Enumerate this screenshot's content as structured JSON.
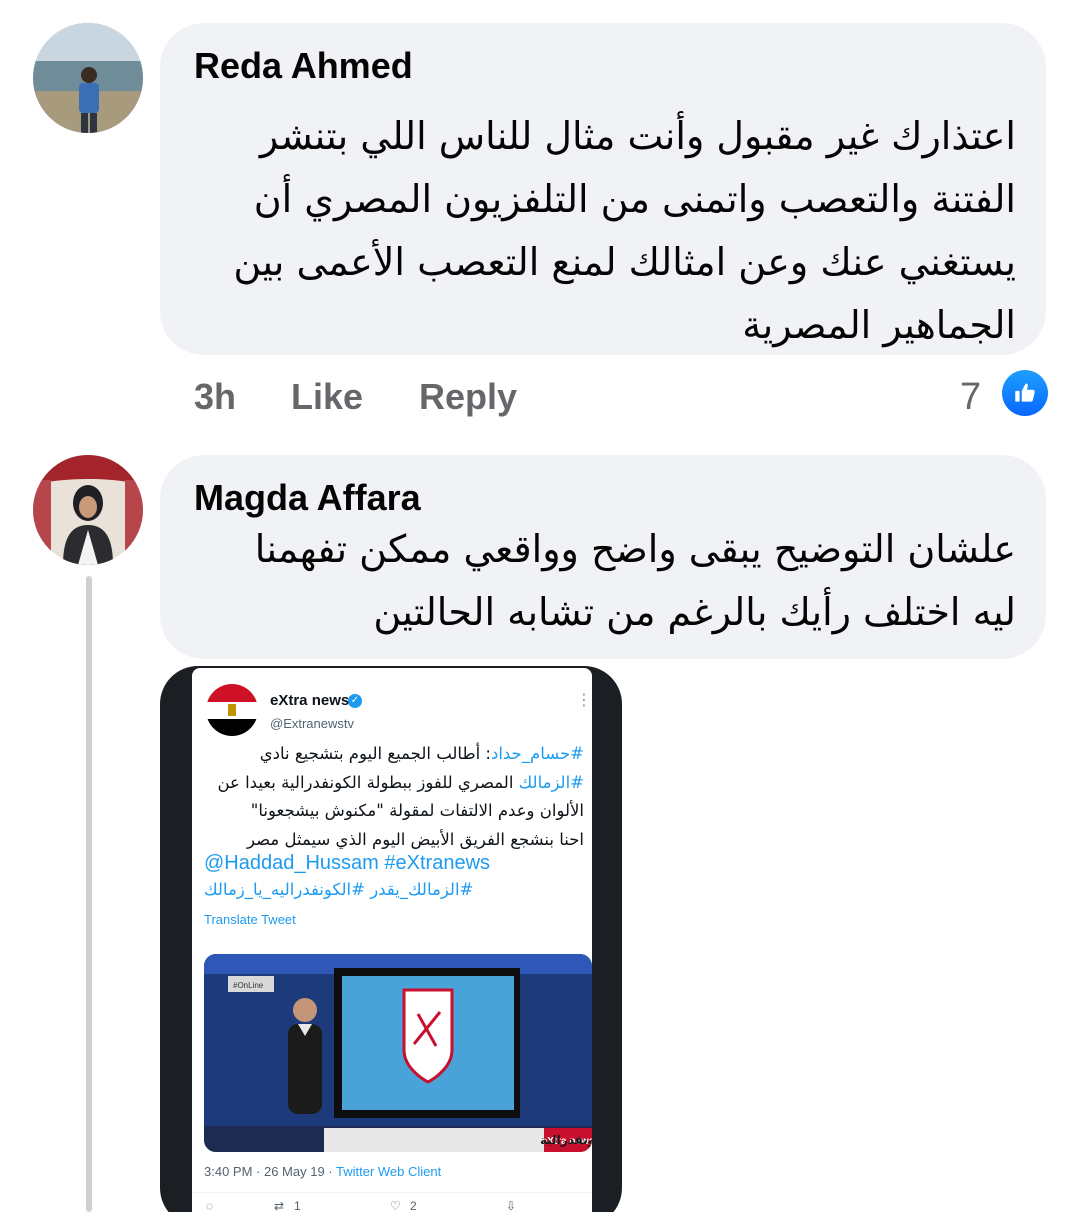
{
  "comments": [
    {
      "author": "Reda Ahmed",
      "text_lines": [
        "اعتذارك غير مقبول وأنت مثال للناس اللي بتنشر",
        "الفتنة والتعصب واتمنى من التلفزيون المصري أن",
        "يستغني عنك وعن امثالك لمنع التعصب الأعمى بين",
        "الجماهير المصرية"
      ],
      "time": "3h",
      "like_label": "Like",
      "reply_label": "Reply",
      "reaction_count": "7",
      "reaction_icon": "thumbs-up-icon",
      "reaction_color": "#1877f2"
    },
    {
      "author": "Magda Affara",
      "text_lines": [
        "علشان التوضيح يبقى واضح وواقعي  ممكن تفهمنا",
        "ليه اختلف رأيك بالرغم من تشابه الحالتين"
      ],
      "attachment": {
        "account_name": "eXtra news",
        "handle": "@Extranewstv",
        "lines": [
          {
            "link": "#حسام_حداد",
            "text": ": أطالب الجميع اليوم بتشجيع نادي"
          },
          {
            "link": "#الزمالك",
            "text": " المصري للفوز ببطولة الكونفدرالية بعيدا عن"
          },
          {
            "link": "",
            "text": "الألوان وعدم الالتفات لمقولة \"مكنوش بيشجعونا\""
          },
          {
            "link": "",
            "text": "احنا بنشجع الفريق الأبيض اليوم الذي سيمثل مصر"
          }
        ],
        "mentions": "@Haddad_Hussam #eXtranews",
        "hashtags": "#الزمالك_يقدر #الكونفدراليه_يا_زمالك",
        "translate": "Translate Tweet",
        "image_caption": "الجماهير تؤازر الزمالك في حلم الكونفدرالية",
        "channel_badge": "#OnLine",
        "channel_logo": "eXtra news",
        "meta_time": "3:40 PM · 26 May 19 · ",
        "meta_source": "Twitter Web Client",
        "retweets": "1",
        "likes": "2"
      }
    }
  ],
  "colors": {
    "bubble": "#f0f2f5",
    "meta_text": "#65676b",
    "tweet_link": "#1d9bf0"
  }
}
